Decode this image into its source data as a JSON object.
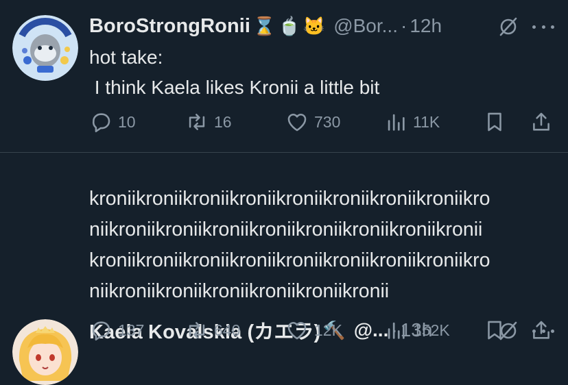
{
  "tweets": [
    {
      "display_name": "BoroStrongRonii",
      "name_emojis": [
        "⌛",
        "🍵",
        "🐱"
      ],
      "handle": "@Bor...",
      "separator": "·",
      "time": "12h",
      "text_lines": [
        "hot take:",
        " I think Kaela likes Kronii a little bit"
      ],
      "replies": "10",
      "reposts": "16",
      "likes": "730",
      "views": "11K"
    },
    {
      "display_name": "Kaela Kovalskia (カエラ)",
      "name_emojis": [
        "🔨"
      ],
      "handle": "@...",
      "separator": "·",
      "time": "13h",
      "text_lines": [
        "kroniikroniikroniikroniikroniikroniikroniikroniikro",
        "niikroniikroniikroniikroniikroniikroniikroniikronii",
        "kroniikroniikroniikroniikroniikroniikroniikroniikro",
        "niikroniikroniikroniikroniikroniikronii"
      ],
      "replies": "137",
      "reposts": "640",
      "likes": "12K",
      "views": "152K"
    }
  ],
  "colors": {
    "background": "#15202b",
    "text_primary": "#e7e9ea",
    "text_secondary": "#8b98a5",
    "divider": "#38444d"
  },
  "icons": [
    "reply-icon",
    "repost-icon",
    "like-icon",
    "views-icon",
    "bookmark-icon",
    "share-icon",
    "grok-icon",
    "more-icon"
  ]
}
